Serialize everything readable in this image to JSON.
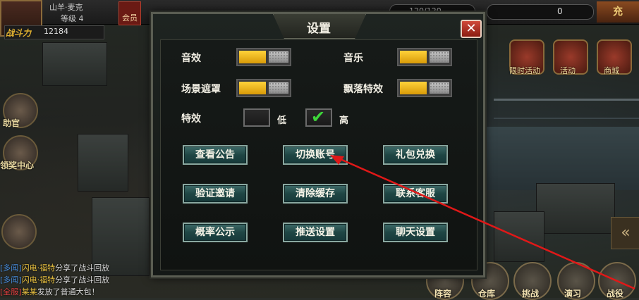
{
  "player": {
    "name": "山羊·麦克",
    "level": "等级 4",
    "power_label": "战斗力",
    "power_value": "12184",
    "vip_label": "会员"
  },
  "resources": {
    "energy_text": "120/120",
    "coin_value": "0",
    "recharge_label": "充"
  },
  "left_menu": [
    {
      "label": "助官"
    },
    {
      "label": "领奖中心"
    }
  ],
  "right_menu": [
    {
      "label": "限时活动"
    },
    {
      "label": "活动"
    },
    {
      "label": "商城"
    }
  ],
  "chat": [
    {
      "tag": "[多闻]",
      "who": "闪电·福特",
      "text": "分享了战斗回放"
    },
    {
      "tag": "[多闻]",
      "who": "闪电·福特",
      "text": "分享了战斗回放"
    },
    {
      "sys": "[全服]",
      "who": "某某",
      "text": "发放了普通大包！"
    }
  ],
  "bottom_bar": [
    {
      "label": "阵容"
    },
    {
      "label": "仓库"
    },
    {
      "label": "挑战"
    },
    {
      "label": "演习"
    },
    {
      "label": "战役"
    }
  ],
  "dialog": {
    "title": "设置",
    "close_symbol": "✕",
    "options": {
      "sound": {
        "label": "音效",
        "on": true
      },
      "music": {
        "label": "音乐",
        "on": true
      },
      "scene_mask": {
        "label": "场景遮罩",
        "on": true
      },
      "falling_effect": {
        "label": "飘落特效",
        "on": true
      }
    },
    "effects": {
      "label": "特效",
      "low_label": "低",
      "high_label": "高",
      "selected": "高"
    },
    "buttons": [
      {
        "label": "查看公告"
      },
      {
        "label": "切换账号"
      },
      {
        "label": "礼包兑换"
      },
      {
        "label": "验证邀请"
      },
      {
        "label": "清除缓存"
      },
      {
        "label": "联系客服"
      },
      {
        "label": "概率公示"
      },
      {
        "label": "推送设置"
      },
      {
        "label": "聊天设置"
      }
    ]
  },
  "colors": {
    "toggle_on": "#f2b914",
    "button_teal": "#1f4644",
    "close_red": "#c0392b",
    "arrow_red": "#e01818",
    "check_green": "#3ed83a"
  }
}
